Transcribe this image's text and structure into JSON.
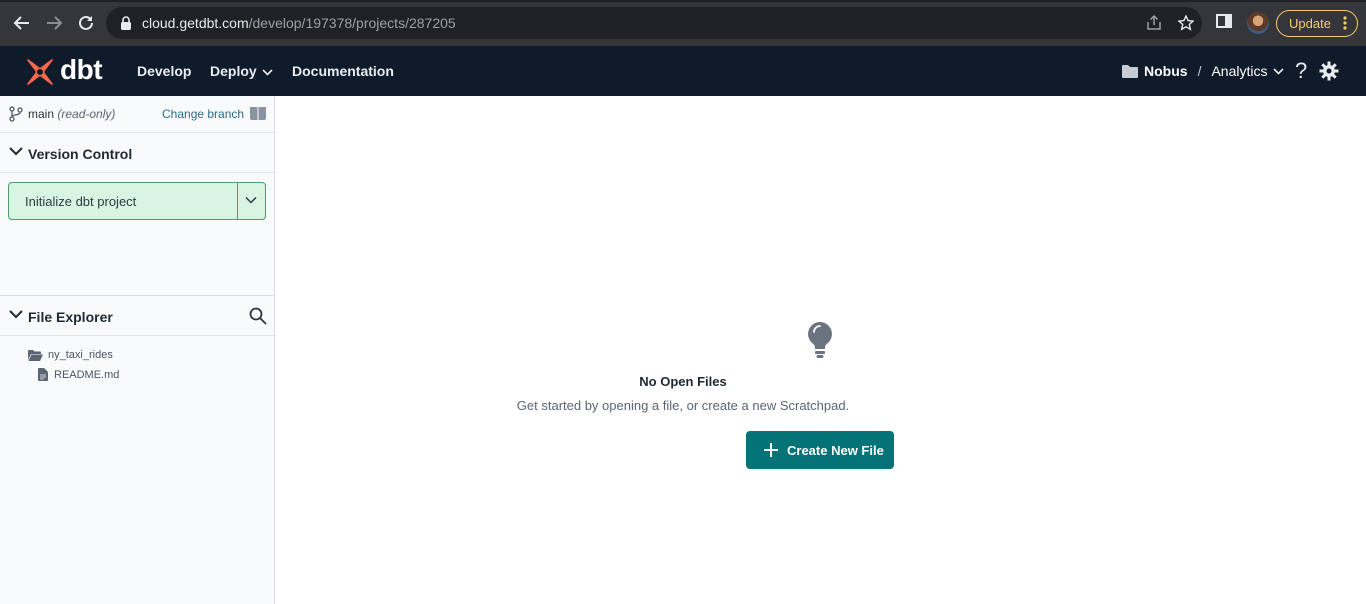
{
  "browser": {
    "url_host": "cloud.getdbt.com",
    "url_path": "/develop/197378/projects/287205",
    "update_label": "Update"
  },
  "header": {
    "logo_text": "dbt",
    "nav": [
      {
        "label": "Develop"
      },
      {
        "label": "Deploy"
      },
      {
        "label": "Documentation"
      }
    ],
    "org": "Nobus",
    "separator": "/",
    "project": "Analytics",
    "help_label": "?"
  },
  "sidebar": {
    "branch": {
      "name": "main",
      "mode": "(read-only)",
      "change_label": "Change branch"
    },
    "version_control": {
      "title": "Version Control",
      "action_label": "Initialize dbt project"
    },
    "file_explorer": {
      "title": "File Explorer",
      "items": [
        {
          "name": "ny_taxi_rides",
          "type": "folder"
        },
        {
          "name": "README.md",
          "type": "file"
        }
      ]
    }
  },
  "main": {
    "empty_title": "No Open Files",
    "empty_subtitle": "Get started by opening a file, or create a new Scratchpad.",
    "create_label": "Create New File"
  },
  "colors": {
    "accent": "#047377",
    "header_bg": "#0f1a2a",
    "logo": "#ff694a",
    "vc_bg": "#d7f5e2",
    "update": "#f9cc69"
  }
}
